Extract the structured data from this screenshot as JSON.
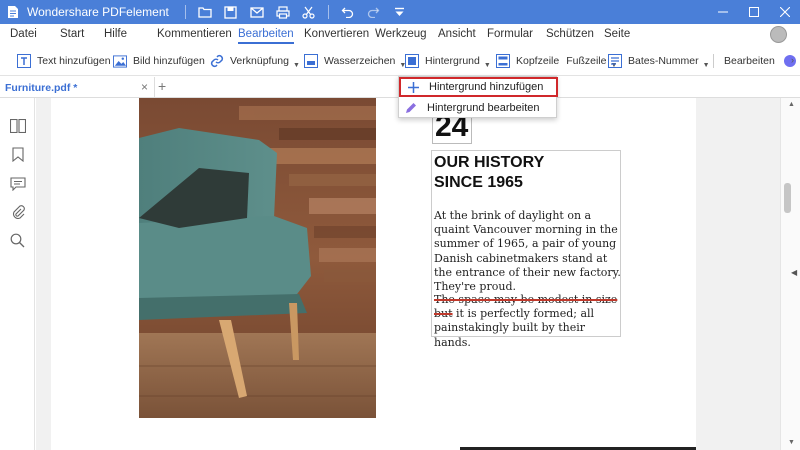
{
  "window": {
    "title": "Wondershare PDFelement"
  },
  "menu": {
    "items": [
      "Datei",
      "Start",
      "Hilfe",
      "Kommentieren",
      "Bearbeiten",
      "Konvertieren",
      "Werkzeug",
      "Ansicht",
      "Formular",
      "Schützen",
      "Seite"
    ],
    "active": "Bearbeiten"
  },
  "toolbar": {
    "text_add": "Text hinzufügen",
    "image_add": "Bild hinzufügen",
    "link": "Verknüpfung",
    "watermark": "Wasserzeichen",
    "background": "Hintergrund",
    "header": "Kopfzeile",
    "footer": "Fußzeile",
    "bates": "Bates-Nummer",
    "edit": "Bearbeiten"
  },
  "tabs": {
    "doc_name": "Furniture.pdf *"
  },
  "dropdown": {
    "add_background": "Hintergrund hinzufügen",
    "edit_background": "Hintergrund bearbeiten"
  },
  "document": {
    "date_number": "24",
    "title_line1": "OUR HISTORY",
    "title_line2": "SINCE 1965",
    "para1": "At the brink of daylight on a quaint Vancouver morning in the summer of 1965, a pair of young Danish cabinetmakers stand at the entrance of their new factory. They're proud.",
    "para2_strike": "The space may be modest in size but",
    "para2_rest": " it is perfectly formed; all painstakingly built by their hands."
  },
  "colors": {
    "titlebar": "#4a7fd8",
    "accent": "#3b6fd4",
    "highlight_border": "#d0282b",
    "band": "#a6868a"
  }
}
